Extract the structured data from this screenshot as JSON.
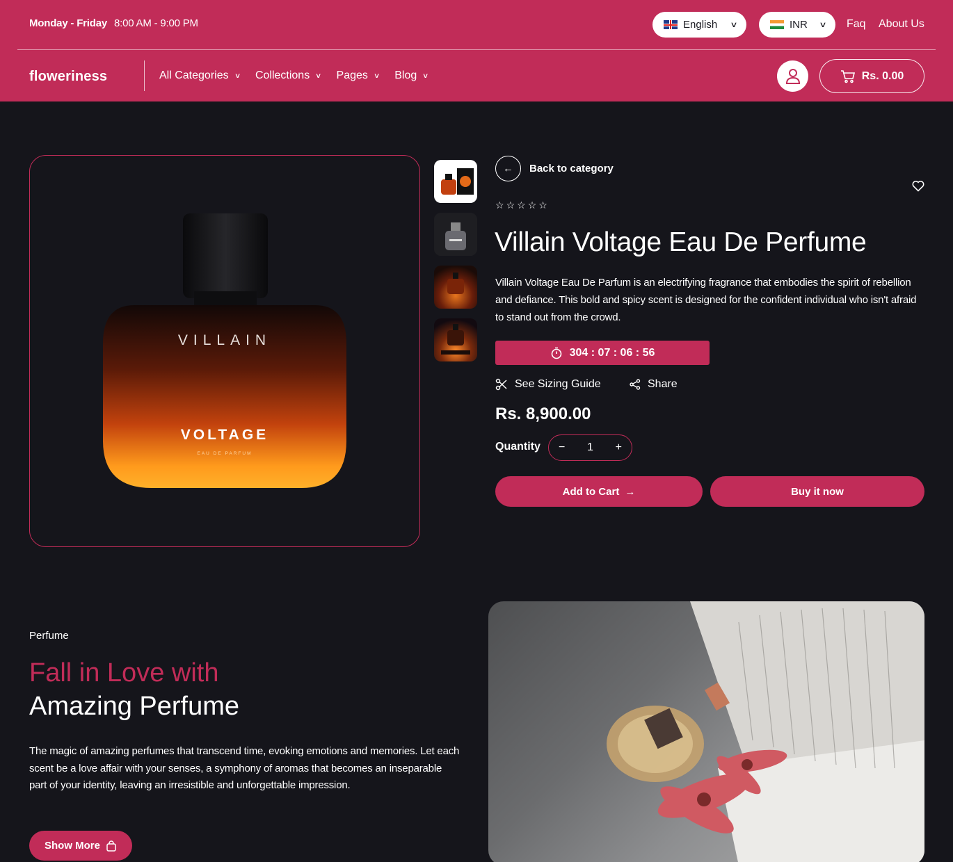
{
  "topbar": {
    "hours_days": "Monday - Friday",
    "hours_time": "8:00 AM - 9:00 PM",
    "language": "English",
    "currency": "INR",
    "links": [
      "Faq",
      "About Us"
    ]
  },
  "nav": {
    "logo": "floweriness",
    "menu": [
      "All Categories",
      "Collections",
      "Pages",
      "Blog"
    ],
    "cart_total": "Rs. 0.00"
  },
  "product": {
    "back_label": "Back to category",
    "rating": 0,
    "title": "Villain Voltage Eau De Perfume",
    "description": "Villain Voltage Eau De Parfum is an electrifying fragrance that embodies the spirit of rebellion and defiance. This bold and spicy scent is designed for the confident individual who isn't afraid to stand out from the crowd.",
    "countdown": "304 : 07 : 06 : 56",
    "sizing_label": "See Sizing Guide",
    "share_label": "Share",
    "price": "Rs. 8,900.00",
    "quantity_label": "Quantity",
    "quantity": "1",
    "add_to_cart": "Add to Cart",
    "buy_now": "Buy it now",
    "bottle_brand": "VILLAIN",
    "bottle_name": "VOLTAGE",
    "bottle_sub": "EAU DE PARFUM"
  },
  "promo": {
    "tag": "Perfume",
    "heading_1": "Fall in Love with",
    "heading_2": "Amazing Perfume",
    "text": "The magic of amazing perfumes that transcend time, evoking emotions and memories. Let each scent be a love affair with your senses, a symphony of aromas that becomes an inseparable part of your identity, leaving an irresistible and unforgettable impression.",
    "button": "Show More"
  },
  "colors": {
    "brand": "#c12c58",
    "background": "#15151b"
  }
}
